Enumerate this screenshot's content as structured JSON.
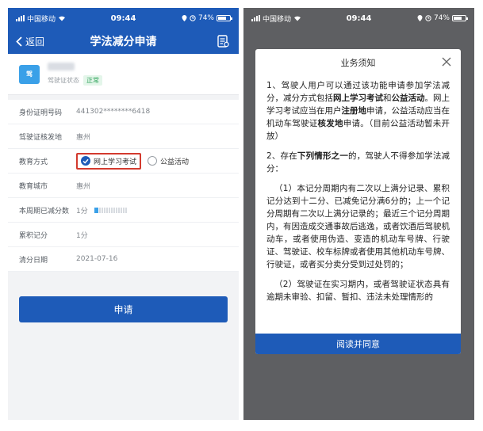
{
  "status_bar": {
    "carrier": "中国移动",
    "time": "09:44",
    "battery": "74%",
    "battery_level": 0.74
  },
  "left": {
    "nav": {
      "back_label": "返回",
      "title": "学法减分申请"
    },
    "license": {
      "icon_text": "驾",
      "status_label": "驾驶证状态",
      "status_value": "正常"
    },
    "rows": [
      {
        "label": "身份证明号码",
        "value": "441302********6418"
      },
      {
        "label": "驾驶证核发地",
        "value": "惠州"
      },
      {
        "label": "教育方式",
        "option_selected": "网上学习考试",
        "option_other": "公益活动"
      },
      {
        "label": "教育城市",
        "value": "惠州"
      },
      {
        "label": "本周期已减分数",
        "value": "1分",
        "progress": 0.12
      },
      {
        "label": "累积记分",
        "value": "1分"
      },
      {
        "label": "清分日期",
        "value": "2021-07-16"
      }
    ],
    "apply_label": "申请"
  },
  "right": {
    "dialog": {
      "title": "业务须知",
      "p1_a": "1、驾驶人用户可以通过该功能申请参加学法减分，减分方式包括",
      "p1_b": "网上学习考试",
      "p1_c": "和",
      "p1_d": "公益活动",
      "p1_e": "。网上学习考试应当在用户",
      "p1_f": "注册地",
      "p1_g": "申请，公益活动应当在机动车驾驶证",
      "p1_h": "核发地",
      "p1_i": "申请。（目前公益活动暂未开放）",
      "p2_a": "2、存在",
      "p2_b": "下列情形之一",
      "p2_c": "的，驾驶人不得参加学法减分：",
      "p3": "（1）本记分周期内有二次以上满分记录、累积记分达到十二分、已减免记分满6分的；上一个记分周期有二次以上满分记录的；最近三个记分周期内，有因造成交通事故后逃逸，或者饮酒后驾驶机动车，或者使用伪造、变造的机动车号牌、行驶证、驾驶证、校车标牌或者使用其他机动车号牌、行驶证，或者买分卖分受到过处罚的；",
      "p4": "（2）驾驶证在实习期内，或者驾驶证状态具有逾期未审验、扣留、暂扣、违法未处理情形的",
      "agree_label": "阅读并同意"
    }
  }
}
